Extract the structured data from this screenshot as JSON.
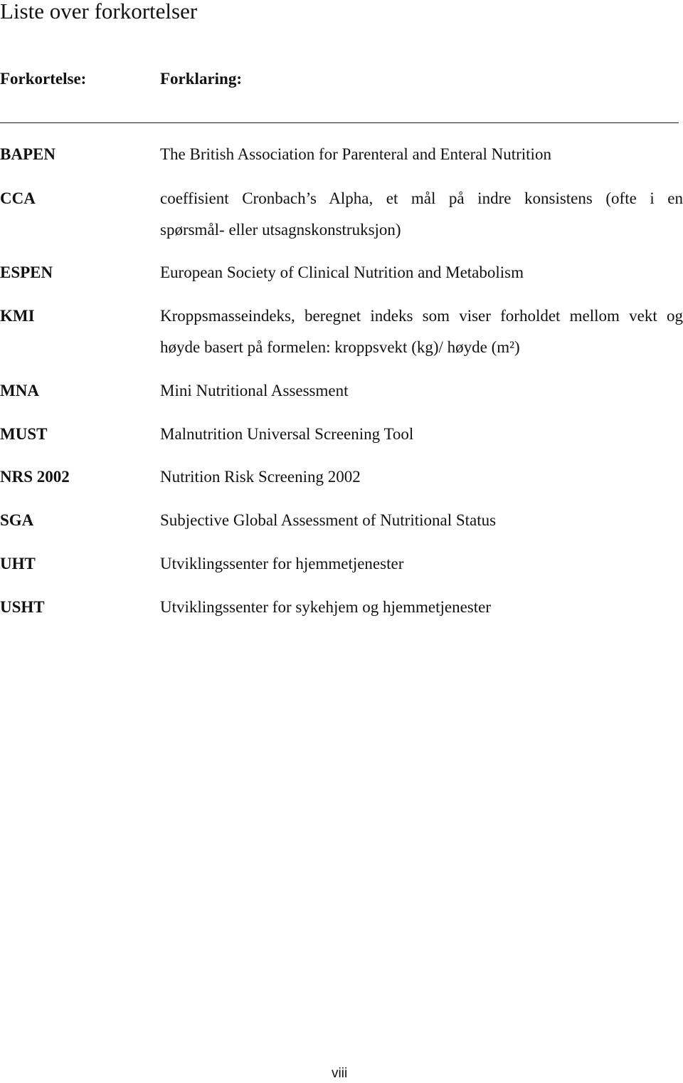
{
  "title": "Liste over forkortelser",
  "headers": {
    "abbreviation": "Forkortelse:",
    "explanation": "Forklaring:"
  },
  "entries": [
    {
      "abbr": "BAPEN",
      "lines": [
        "The British Association for Parenteral and Enteral Nutrition"
      ]
    },
    {
      "abbr": "CCA",
      "lines": [
        "coeffisient Cronbach’s Alpha, et mål på indre konsistens (ofte i en",
        "spørsmål- eller utsagnskonstruksjon)"
      ]
    },
    {
      "abbr": "ESPEN",
      "lines": [
        "European Society of Clinical Nutrition and Metabolism"
      ]
    },
    {
      "abbr": "KMI",
      "lines": [
        "Kroppsmasseindeks, beregnet indeks som viser forholdet mellom vekt og",
        "høyde basert på formelen: kroppsvekt (kg)/ høyde (m²)"
      ]
    },
    {
      "abbr": "MNA",
      "lines": [
        "Mini Nutritional Assessment"
      ]
    },
    {
      "abbr": "MUST",
      "lines": [
        "Malnutrition Universal Screening Tool"
      ]
    },
    {
      "abbr": "NRS 2002",
      "lines": [
        "Nutrition Risk Screening 2002"
      ]
    },
    {
      "abbr": "SGA",
      "lines": [
        "Subjective Global Assessment of Nutritional Status"
      ]
    },
    {
      "abbr": "UHT",
      "lines": [
        "Utviklingssenter for hjemmetjenester"
      ]
    },
    {
      "abbr": "USHT",
      "lines": [
        "Utviklingssenter for sykehjem og hjemmetjenester"
      ]
    }
  ],
  "page_number": "viii"
}
